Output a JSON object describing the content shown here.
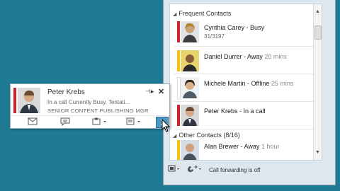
{
  "groups": {
    "frequent_label": "Frequent Contacts",
    "other_label": "Other Contacts (8/16)"
  },
  "contacts": [
    {
      "name": "Cynthia Carey - Busy",
      "time": "",
      "sub": "31/3197",
      "presence": "#d2232a"
    },
    {
      "name": "Daniel Durrer - Away",
      "time": " 20 mins",
      "sub": "",
      "presence": "#f3c20b"
    },
    {
      "name": "Michele Martin - Offline",
      "time": " 25 mins",
      "sub": "",
      "presence": "#ffffff"
    },
    {
      "name": "Peter Krebs - In a call",
      "time": "",
      "sub": "",
      "presence": "#d2232a"
    }
  ],
  "other_contacts": [
    {
      "name": "Alan Brewer - Away",
      "time": " 1 hour",
      "presence": "#f3c20b"
    }
  ],
  "footer": {
    "call_forwarding": "Call forwarding is off"
  },
  "card": {
    "name": "Peter Krebs",
    "status": "In a call    Currently Busy. Tentati...",
    "title": "SENIOR CONTENT PUBLISHING MGR",
    "presence": "#d2232a"
  },
  "icons": {
    "pin": "pin-icon",
    "close": "close-icon",
    "email": "email-icon",
    "im": "instant-message-icon",
    "call": "call-icon",
    "meeting": "meeting-icon",
    "expand": "expand-icon"
  },
  "colors": {
    "background": "#1f7a93",
    "busy": "#d2232a",
    "away": "#f3c20b"
  }
}
